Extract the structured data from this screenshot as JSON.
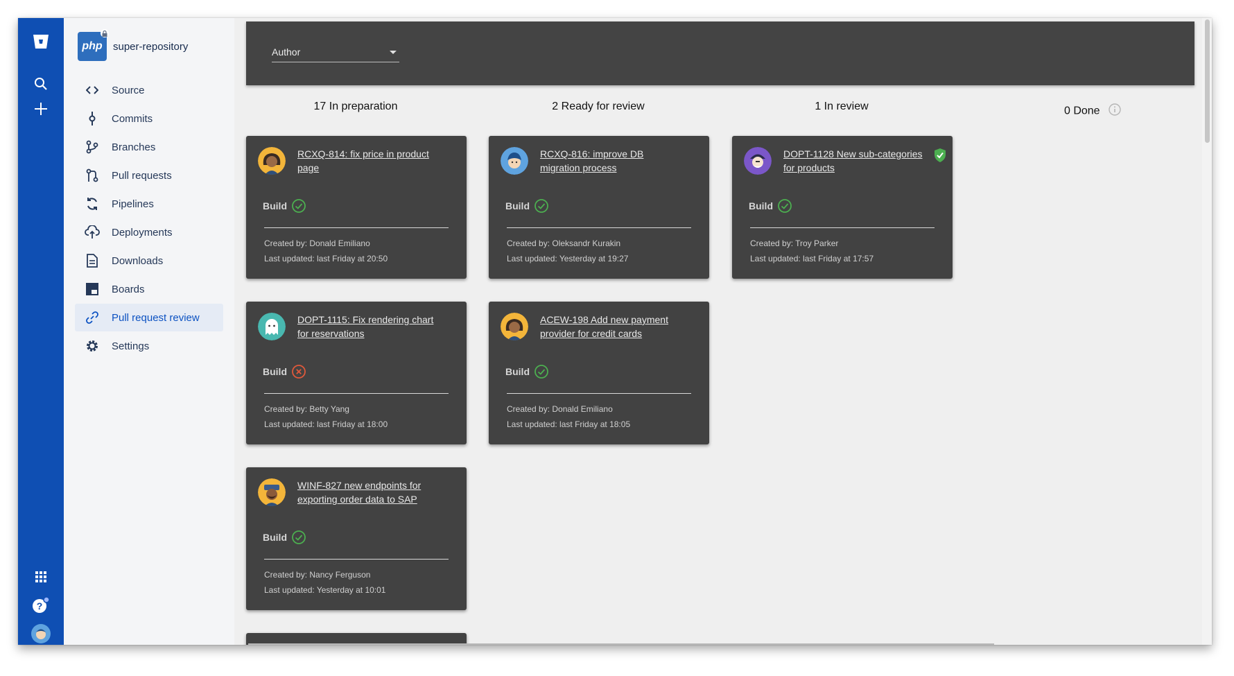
{
  "repo": {
    "name": "super-repository",
    "logo_text": "php"
  },
  "global_nav": {
    "top_icons": [
      "bitbucket-logo-icon",
      "search-icon",
      "plus-icon"
    ],
    "bottom_icons": [
      "apps-grid-icon",
      "help-icon",
      "user-avatar-icon"
    ]
  },
  "sidebar": {
    "items": [
      {
        "label": "Source",
        "icon": "code-icon"
      },
      {
        "label": "Commits",
        "icon": "commit-icon"
      },
      {
        "label": "Branches",
        "icon": "branch-icon"
      },
      {
        "label": "Pull requests",
        "icon": "pull-request-icon"
      },
      {
        "label": "Pipelines",
        "icon": "pipelines-icon"
      },
      {
        "label": "Deployments",
        "icon": "cloud-upload-icon"
      },
      {
        "label": "Downloads",
        "icon": "file-icon"
      },
      {
        "label": "Boards",
        "icon": "board-icon"
      },
      {
        "label": "Pull request review",
        "icon": "link-icon",
        "active": true
      },
      {
        "label": "Settings",
        "icon": "gear-icon"
      }
    ]
  },
  "filter": {
    "author_label": "Author"
  },
  "columns": [
    {
      "label": "17 In preparation"
    },
    {
      "label": "2 Ready for review"
    },
    {
      "label": "1 In review"
    },
    {
      "label": "0 Done"
    }
  ],
  "cards": [
    {
      "title": "RCXQ-814: fix price in product page",
      "build_label": "Build",
      "build_status": "success",
      "created_by": "Created by: Donald Emiliano",
      "last_updated": "Last updated: last Friday at 20:50",
      "avatar": "woman-avatar"
    },
    {
      "title": "DOPT-1115: Fix rendering chart for reservations",
      "build_label": "Build",
      "build_status": "failed",
      "created_by": "Created by: Betty Yang",
      "last_updated": "Last updated: last Friday at 18:00",
      "avatar": "ghost-avatar"
    },
    {
      "title": "WINF-827 new endpoints for exporting order data to SAP",
      "build_label": "Build",
      "build_status": "success",
      "created_by": "Created by: Nancy Ferguson",
      "last_updated": "Last updated: Yesterday at 10:01",
      "avatar": "man-cap-avatar"
    },
    {
      "title": "RCXQ-816: improve DB migration process",
      "build_label": "Build",
      "build_status": "success",
      "created_by": "Created by: Oleksandr Kurakin",
      "last_updated": "Last updated: Yesterday at 19:27",
      "avatar": "man-blue-avatar"
    },
    {
      "title": "ACEW-198 Add new payment provider for credit cards",
      "build_label": "Build",
      "build_status": "success",
      "created_by": "Created by: Donald Emiliano",
      "last_updated": "Last updated: last Friday at 18:05",
      "avatar": "woman-avatar"
    },
    {
      "title": "DOPT-1128 New sub-categories for products",
      "build_label": "Build",
      "build_status": "success",
      "approved": true,
      "created_by": "Created by: Troy Parker",
      "last_updated": "Last updated: last Friday at 17:57",
      "avatar": "pirate-avatar"
    }
  ],
  "colors": {
    "nav_blue": "#0f4fb3",
    "card_bg": "#424242",
    "success": "#4caf50",
    "failed": "#e0593b",
    "active_link": "#0c52c2"
  }
}
